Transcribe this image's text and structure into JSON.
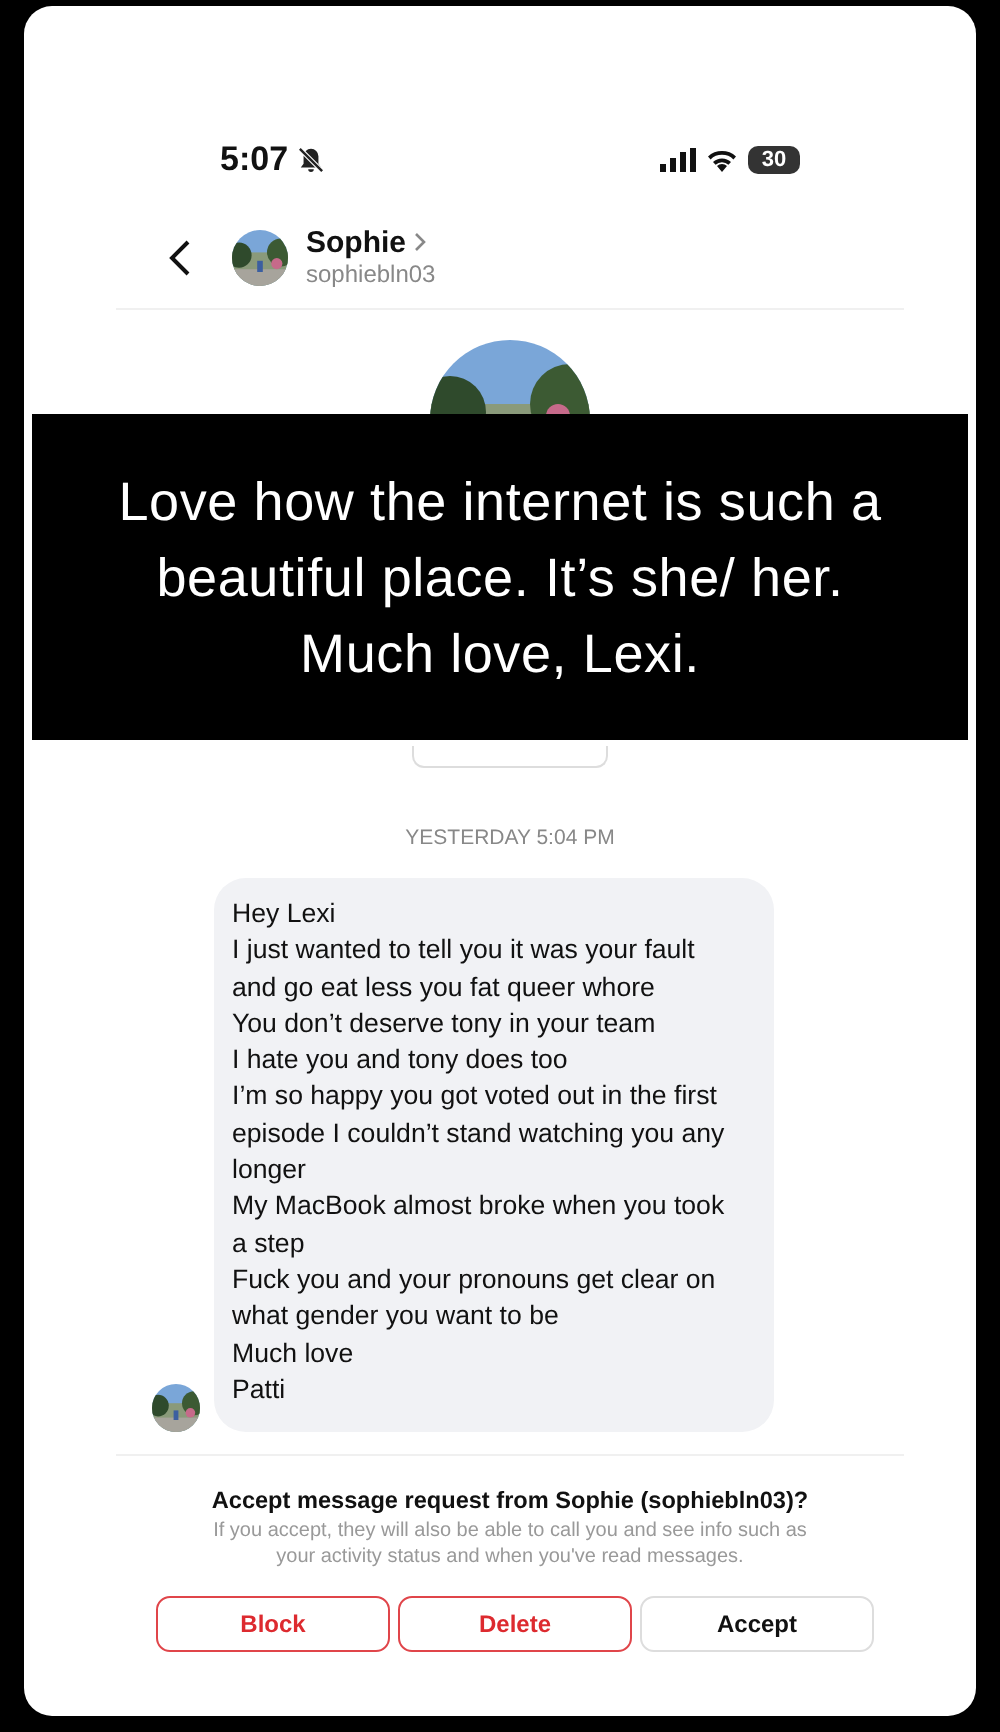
{
  "status_bar": {
    "time": "5:07",
    "muted": true,
    "battery": "30"
  },
  "header": {
    "name": "Sophie",
    "username": "sophiebln03"
  },
  "caption": "Love how the internet is such a beautiful place. It’s she/ her. Much love, Lexi.",
  "timestamp": "YESTERDAY 5:04 PM",
  "message_lines": [
    "Hey Lexi",
    "I just wanted to tell you it was your fault and go eat less you fat queer whore",
    "You don’t deserve tony in your team",
    "I hate you and tony does too",
    "I’m so happy you got voted out in the first episode I couldn’t stand watching you any longer",
    "My MacBook almost broke when you took a step",
    "Fuck you and your pronouns get clear on what gender you want to be",
    "Much love",
    "Patti"
  ],
  "request": {
    "title": "Accept message request from Sophie (sophiebln03)?",
    "description": "If you accept, they will also be able to call you and see info such as your activity status and when you've read messages."
  },
  "buttons": [
    {
      "label": "Block",
      "kind": "danger"
    },
    {
      "label": "Delete",
      "kind": "danger"
    },
    {
      "label": "Accept",
      "kind": "normal"
    }
  ]
}
